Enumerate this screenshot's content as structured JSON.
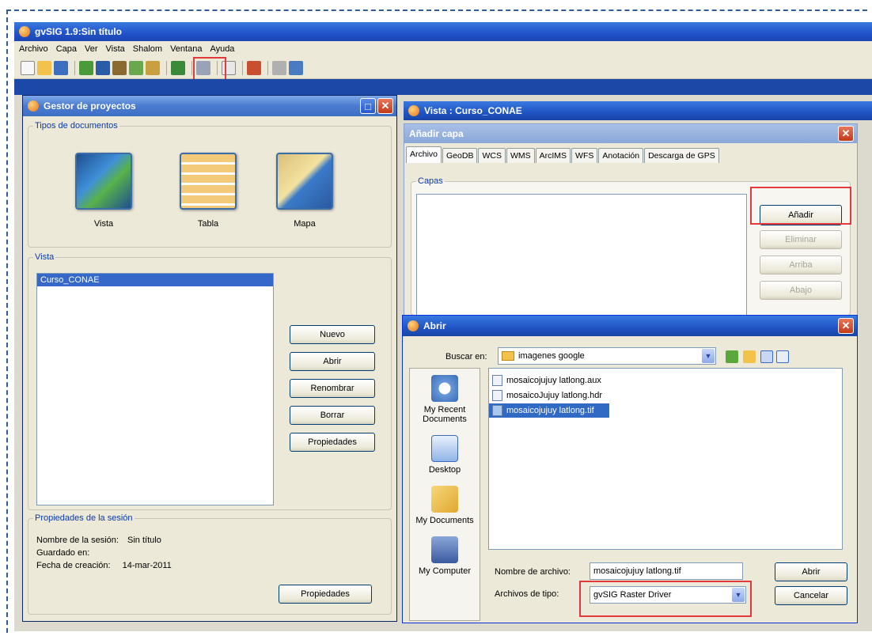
{
  "app": {
    "title": "gvSIG 1.9:Sin título"
  },
  "menu": [
    "Archivo",
    "Capa",
    "Ver",
    "Vista",
    "Shalom",
    "Ventana",
    "Ayuda"
  ],
  "gestor": {
    "title": "Gestor de proyectos",
    "tipos_legend": "Tipos de documentos",
    "doc_types": [
      "Vista",
      "Tabla",
      "Mapa"
    ],
    "vista_legend": "Vista",
    "items": [
      "Curso_CONAE"
    ],
    "buttons": [
      "Nuevo",
      "Abrir",
      "Renombrar",
      "Borrar",
      "Propiedades"
    ],
    "session": {
      "legend": "Propiedades de la sesión",
      "name_label": "Nombre de la sesión:",
      "name_value": "Sin título",
      "saved_label": "Guardado en:",
      "date_label": "Fecha de creación:",
      "date_value": "14-mar-2011",
      "props_button": "Propiedades"
    }
  },
  "vista_window": {
    "title": "Vista : Curso_CONAE"
  },
  "anadir": {
    "title": "Añadir capa",
    "tabs": [
      "Archivo",
      "GeoDB",
      "WCS",
      "WMS",
      "ArcIMS",
      "WFS",
      "Anotación",
      "Descarga de GPS"
    ],
    "capas_legend": "Capas",
    "buttons": {
      "add": "Añadir",
      "remove": "Eliminar",
      "up": "Arriba",
      "down": "Abajo"
    }
  },
  "abrir": {
    "title": "Abrir",
    "look_in_label": "Buscar en:",
    "look_in_value": "imagenes google",
    "places": [
      "My Recent Documents",
      "Desktop",
      "My Documents",
      "My Computer"
    ],
    "files": [
      "mosaicojujuy latlong.aux",
      "mosaicoJujuy latlong.hdr",
      "mosaicojujuy latlong.tif"
    ],
    "selected_file": "mosaicojujuy latlong.tif",
    "filename_label": "Nombre de archivo:",
    "filename_value": "mosaicojujuy latlong.tif",
    "filetype_label": "Archivos de tipo:",
    "filetype_value": "gvSIG Raster Driver",
    "open_button": "Abrir",
    "cancel_button": "Cancelar"
  },
  "colors": {
    "highlight": "#e23a3a",
    "xp_blue": "#2052c8",
    "selection": "#316ac5"
  }
}
